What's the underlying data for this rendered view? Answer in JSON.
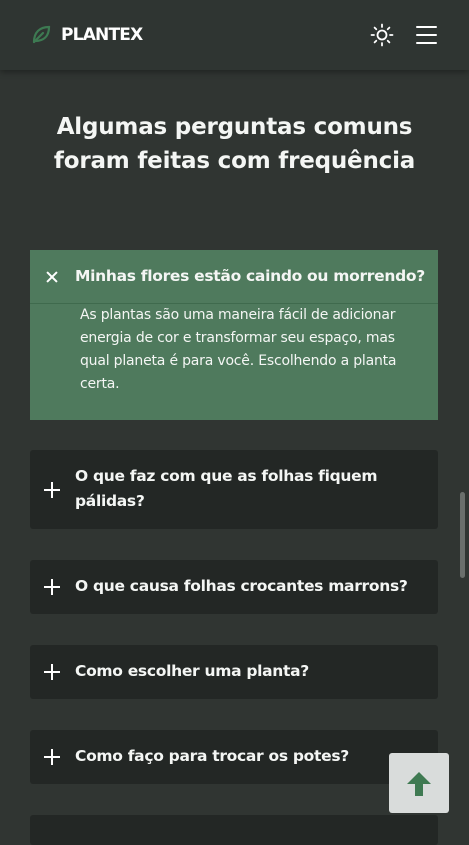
{
  "header": {
    "logo_text": "PLANTEX",
    "logo_icon": "leaf-icon",
    "theme_icon": "sun-icon",
    "menu_icon": "hamburger-menu-icon"
  },
  "title": {
    "line1": "Algumas perguntas comuns",
    "line2": "foram feitas com frequência"
  },
  "faq": [
    {
      "question": "Minhas flores estão caindo ou morrendo?",
      "answer": "As plantas são uma maneira fácil de adicionar energia de cor e transformar seu espaço, mas qual planeta é para você. Escolhendo a planta certa.",
      "expanded": true,
      "icon": "close-icon"
    },
    {
      "question": "O que faz com que as folhas fiquem pálidas?",
      "expanded": false,
      "icon": "plus-icon"
    },
    {
      "question": "O que causa folhas crocantes marrons?",
      "expanded": false,
      "icon": "plus-icon"
    },
    {
      "question": "Como escolher uma planta?",
      "expanded": false,
      "icon": "plus-icon"
    },
    {
      "question": "Como faço para trocar os potes?",
      "expanded": false,
      "icon": "plus-icon"
    }
  ],
  "scroll_top": {
    "icon": "arrow-up-icon"
  },
  "colors": {
    "background": "#303532",
    "card": "#232725",
    "accent_open": "#4f7a5d",
    "brand_green": "#3f7a52",
    "scroll_button": "#d9dcdb"
  }
}
